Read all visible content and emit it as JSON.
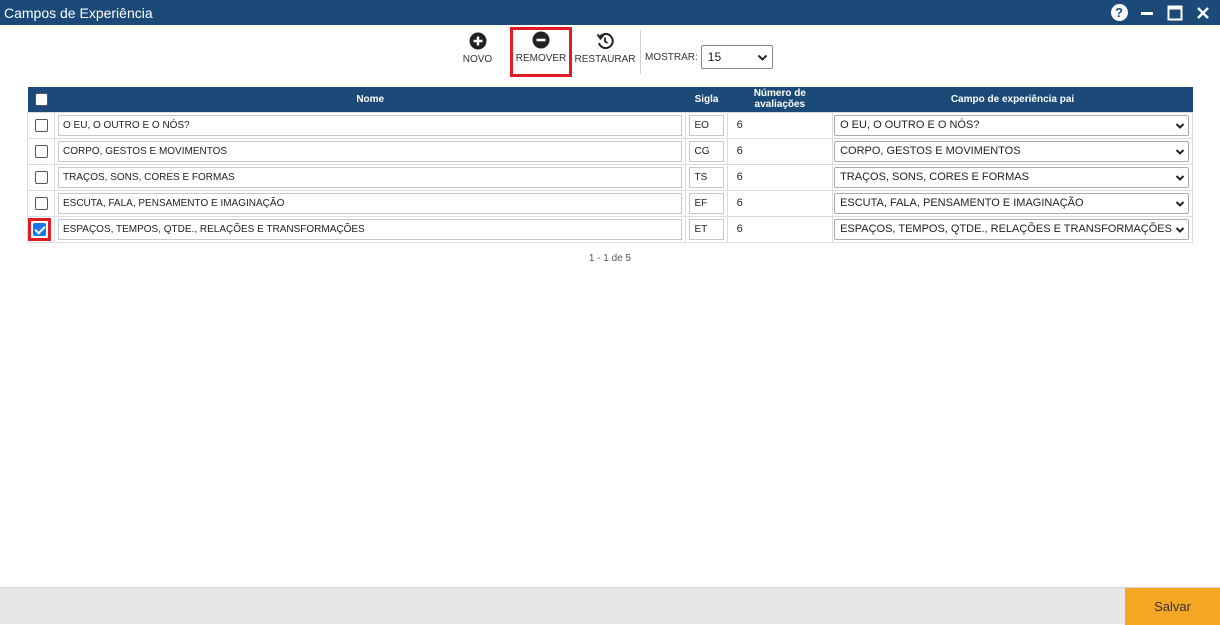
{
  "window": {
    "title": "Campos de Experiência",
    "help_icon": "help-icon",
    "minimize_icon": "minimize-icon",
    "maximize_icon": "maximize-icon",
    "close_icon": "close-icon"
  },
  "toolbar": {
    "novo_label": "NOVO",
    "remover_label": "REMOVER",
    "restaurar_label": "RESTAURAR",
    "mostrar_label": "MOSTRAR:",
    "mostrar_value": "15",
    "highlight_color": "#e01b24"
  },
  "grid": {
    "headers": {
      "nome": "Nome",
      "sigla": "Sigla",
      "num": "Número de avaliações",
      "pai": "Campo de experiência pai"
    },
    "header_color": "#1b4a78",
    "rows": [
      {
        "checked": false,
        "nome": "O EU, O OUTRO E O NÓS?",
        "sigla": "EO",
        "num": "6",
        "pai": "O EU, O OUTRO E O NÓS?"
      },
      {
        "checked": false,
        "nome": "CORPO, GESTOS E MOVIMENTOS",
        "sigla": "CG",
        "num": "6",
        "pai": "CORPO, GESTOS E MOVIMENTOS"
      },
      {
        "checked": false,
        "nome": "TRAÇOS, SONS, CORES E FORMAS",
        "sigla": "TS",
        "num": "6",
        "pai": "TRAÇOS, SONS, CORES E FORMAS"
      },
      {
        "checked": false,
        "nome": "ESCUTA, FALA, PENSAMENTO E IMAGINAÇÃO",
        "sigla": "EF",
        "num": "6",
        "pai": "ESCUTA, FALA, PENSAMENTO E IMAGINAÇÃO"
      },
      {
        "checked": true,
        "nome": "ESPAÇOS, TEMPOS, QTDE., RELAÇÕES E TRANSFORMAÇÕES",
        "sigla": "ET",
        "num": "6",
        "pai": "ESPAÇOS, TEMPOS, QTDE., RELAÇÕES E TRANSFORMAÇÕES"
      }
    ]
  },
  "pager": {
    "text": "1 - 1 de 5"
  },
  "footer": {
    "save_label": "Salvar",
    "save_color": "#f5a623"
  }
}
